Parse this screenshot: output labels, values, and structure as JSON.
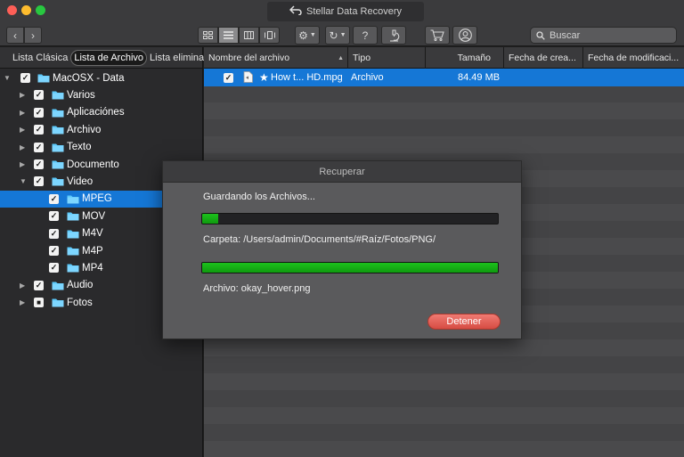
{
  "window": {
    "title": "Stellar Data Recovery"
  },
  "toolbar": {
    "nav_back": "‹",
    "nav_forward": "›",
    "help": "?",
    "search_placeholder": "Buscar"
  },
  "sidebar": {
    "tabs": [
      {
        "label": "Lista Clásica",
        "active": false
      },
      {
        "label": "Lista de Archivo",
        "active": true
      },
      {
        "label": "Lista eliminada",
        "active": false
      }
    ],
    "tree": [
      {
        "label": "MacOSX - Data",
        "level": 0,
        "expanded": true,
        "checked": true,
        "selected": false
      },
      {
        "label": "Varios",
        "level": 1,
        "expanded": false,
        "checked": true,
        "selected": false
      },
      {
        "label": "Aplicaciónes",
        "level": 1,
        "expanded": false,
        "checked": true,
        "selected": false
      },
      {
        "label": "Archivo",
        "level": 1,
        "expanded": false,
        "checked": true,
        "selected": false
      },
      {
        "label": "Texto",
        "level": 1,
        "expanded": false,
        "checked": true,
        "selected": false
      },
      {
        "label": "Documento",
        "level": 1,
        "expanded": false,
        "checked": true,
        "selected": false
      },
      {
        "label": "Video",
        "level": 1,
        "expanded": true,
        "checked": true,
        "selected": false
      },
      {
        "label": "MPEG",
        "level": 2,
        "checked": true,
        "selected": true
      },
      {
        "label": "MOV",
        "level": 2,
        "checked": true,
        "selected": false
      },
      {
        "label": "M4V",
        "level": 2,
        "checked": true,
        "selected": false
      },
      {
        "label": "M4P",
        "level": 2,
        "checked": true,
        "selected": false
      },
      {
        "label": "MP4",
        "level": 2,
        "checked": true,
        "selected": false
      },
      {
        "label": "Audio",
        "level": 1,
        "expanded": false,
        "checked": true,
        "selected": false
      },
      {
        "label": "Fotos",
        "level": 1,
        "expanded": false,
        "checked": "partial",
        "selected": false
      }
    ]
  },
  "file_list": {
    "columns": [
      "Nombre del archivo",
      "Tipo",
      "Tamaño",
      "Fecha de crea...",
      "Fecha de modificaci..."
    ],
    "rows": [
      {
        "name": "How t... HD.mpg",
        "type": "Archivo",
        "size": "84.49 MB",
        "created": "",
        "modified": "",
        "starred": true,
        "checked": true,
        "selected": true
      }
    ]
  },
  "dialog": {
    "title": "Recuperar",
    "status": "Guardando los Archivos...",
    "overall_progress": 0.055,
    "folder_text": "Carpeta: /Users/admin/Documents/#Raíz/Fotos/PNG/",
    "file_progress": 1.0,
    "file_text": "Archivo: okay_hover.png",
    "stop_label": "Detener"
  },
  "colors": {
    "selection": "#1577d6",
    "progress_green": "#14b014",
    "stop_button": "#e0584f",
    "folder": "#5ac8fa"
  },
  "icons": {
    "search": "magnifier",
    "gear": "gear",
    "history": "clock-arrow",
    "scan": "microscope",
    "cart": "shopping-cart",
    "user": "user-circle",
    "view_icons": "grid",
    "view_list": "list",
    "view_columns": "columns",
    "view_cover": "cover-flow"
  }
}
